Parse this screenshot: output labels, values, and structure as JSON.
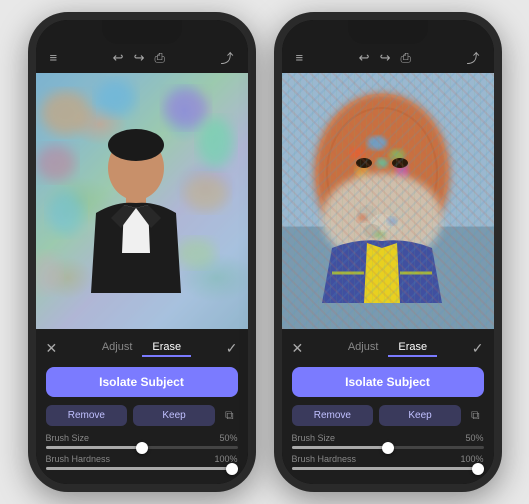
{
  "phones": [
    {
      "id": "phone-left",
      "topbar": {
        "menu_icon": "≡",
        "undo_icon": "↩",
        "redo_icon": "↪",
        "print_icon": "⎙",
        "share_icon": "⤴"
      },
      "panel": {
        "close_icon": "✕",
        "checkmark_icon": "✓",
        "tab_adjust": "Adjust",
        "tab_erase": "Erase",
        "isolate_btn": "Isolate Subject",
        "remove_btn": "Remove",
        "keep_btn": "Keep",
        "clipboard_icon": "⧉",
        "brush_size_label": "Brush Size",
        "brush_size_value": "50%",
        "brush_hardness_label": "Brush Hardness",
        "brush_hardness_value": "100%",
        "brush_size_pct": 50,
        "brush_hardness_pct": 100
      }
    },
    {
      "id": "phone-right",
      "topbar": {
        "menu_icon": "≡",
        "undo_icon": "↩",
        "redo_icon": "↪",
        "print_icon": "⎙",
        "share_icon": "⤴"
      },
      "panel": {
        "close_icon": "✕",
        "checkmark_icon": "✓",
        "tab_adjust": "Adjust",
        "tab_erase": "Erase",
        "isolate_btn": "Isolate Subject",
        "remove_btn": "Remove",
        "keep_btn": "Keep",
        "clipboard_icon": "⧉",
        "brush_size_label": "Brush Size",
        "brush_size_value": "50%",
        "brush_hardness_label": "Brush Hardness",
        "brush_hardness_value": "100%",
        "brush_size_pct": 50,
        "brush_hardness_pct": 100
      }
    }
  ],
  "colors": {
    "accent": "#7b7bff",
    "bg_dark": "#1e1e1e",
    "tab_active_color": "#ffffff",
    "tab_inactive_color": "#888888",
    "remove_keep_bg": "#3a3a5c",
    "remove_keep_fg": "#c0c0ff"
  }
}
